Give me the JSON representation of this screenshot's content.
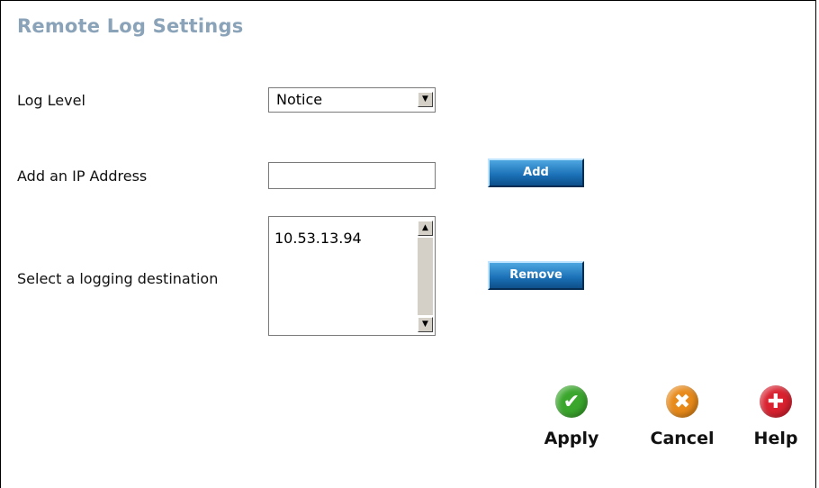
{
  "page": {
    "title": "Remote Log Settings"
  },
  "log_level": {
    "label": "Log Level",
    "selected": "Notice"
  },
  "add_ip": {
    "label": "Add an IP Address",
    "value": "",
    "button_label": "Add"
  },
  "destination": {
    "label": "Select a logging destination",
    "items": [
      "10.53.13.94"
    ],
    "button_label": "Remove"
  },
  "actions": {
    "apply": {
      "label": "Apply",
      "icon": "checkmark-icon",
      "color": "#3aa62c"
    },
    "cancel": {
      "label": "Cancel",
      "icon": "x-icon",
      "color": "#e88a1a"
    },
    "help": {
      "label": "Help",
      "icon": "plus-icon",
      "color": "#d9212f"
    }
  },
  "colors": {
    "title": "#8aa3b8",
    "button_blue": "#1a6fb5"
  }
}
